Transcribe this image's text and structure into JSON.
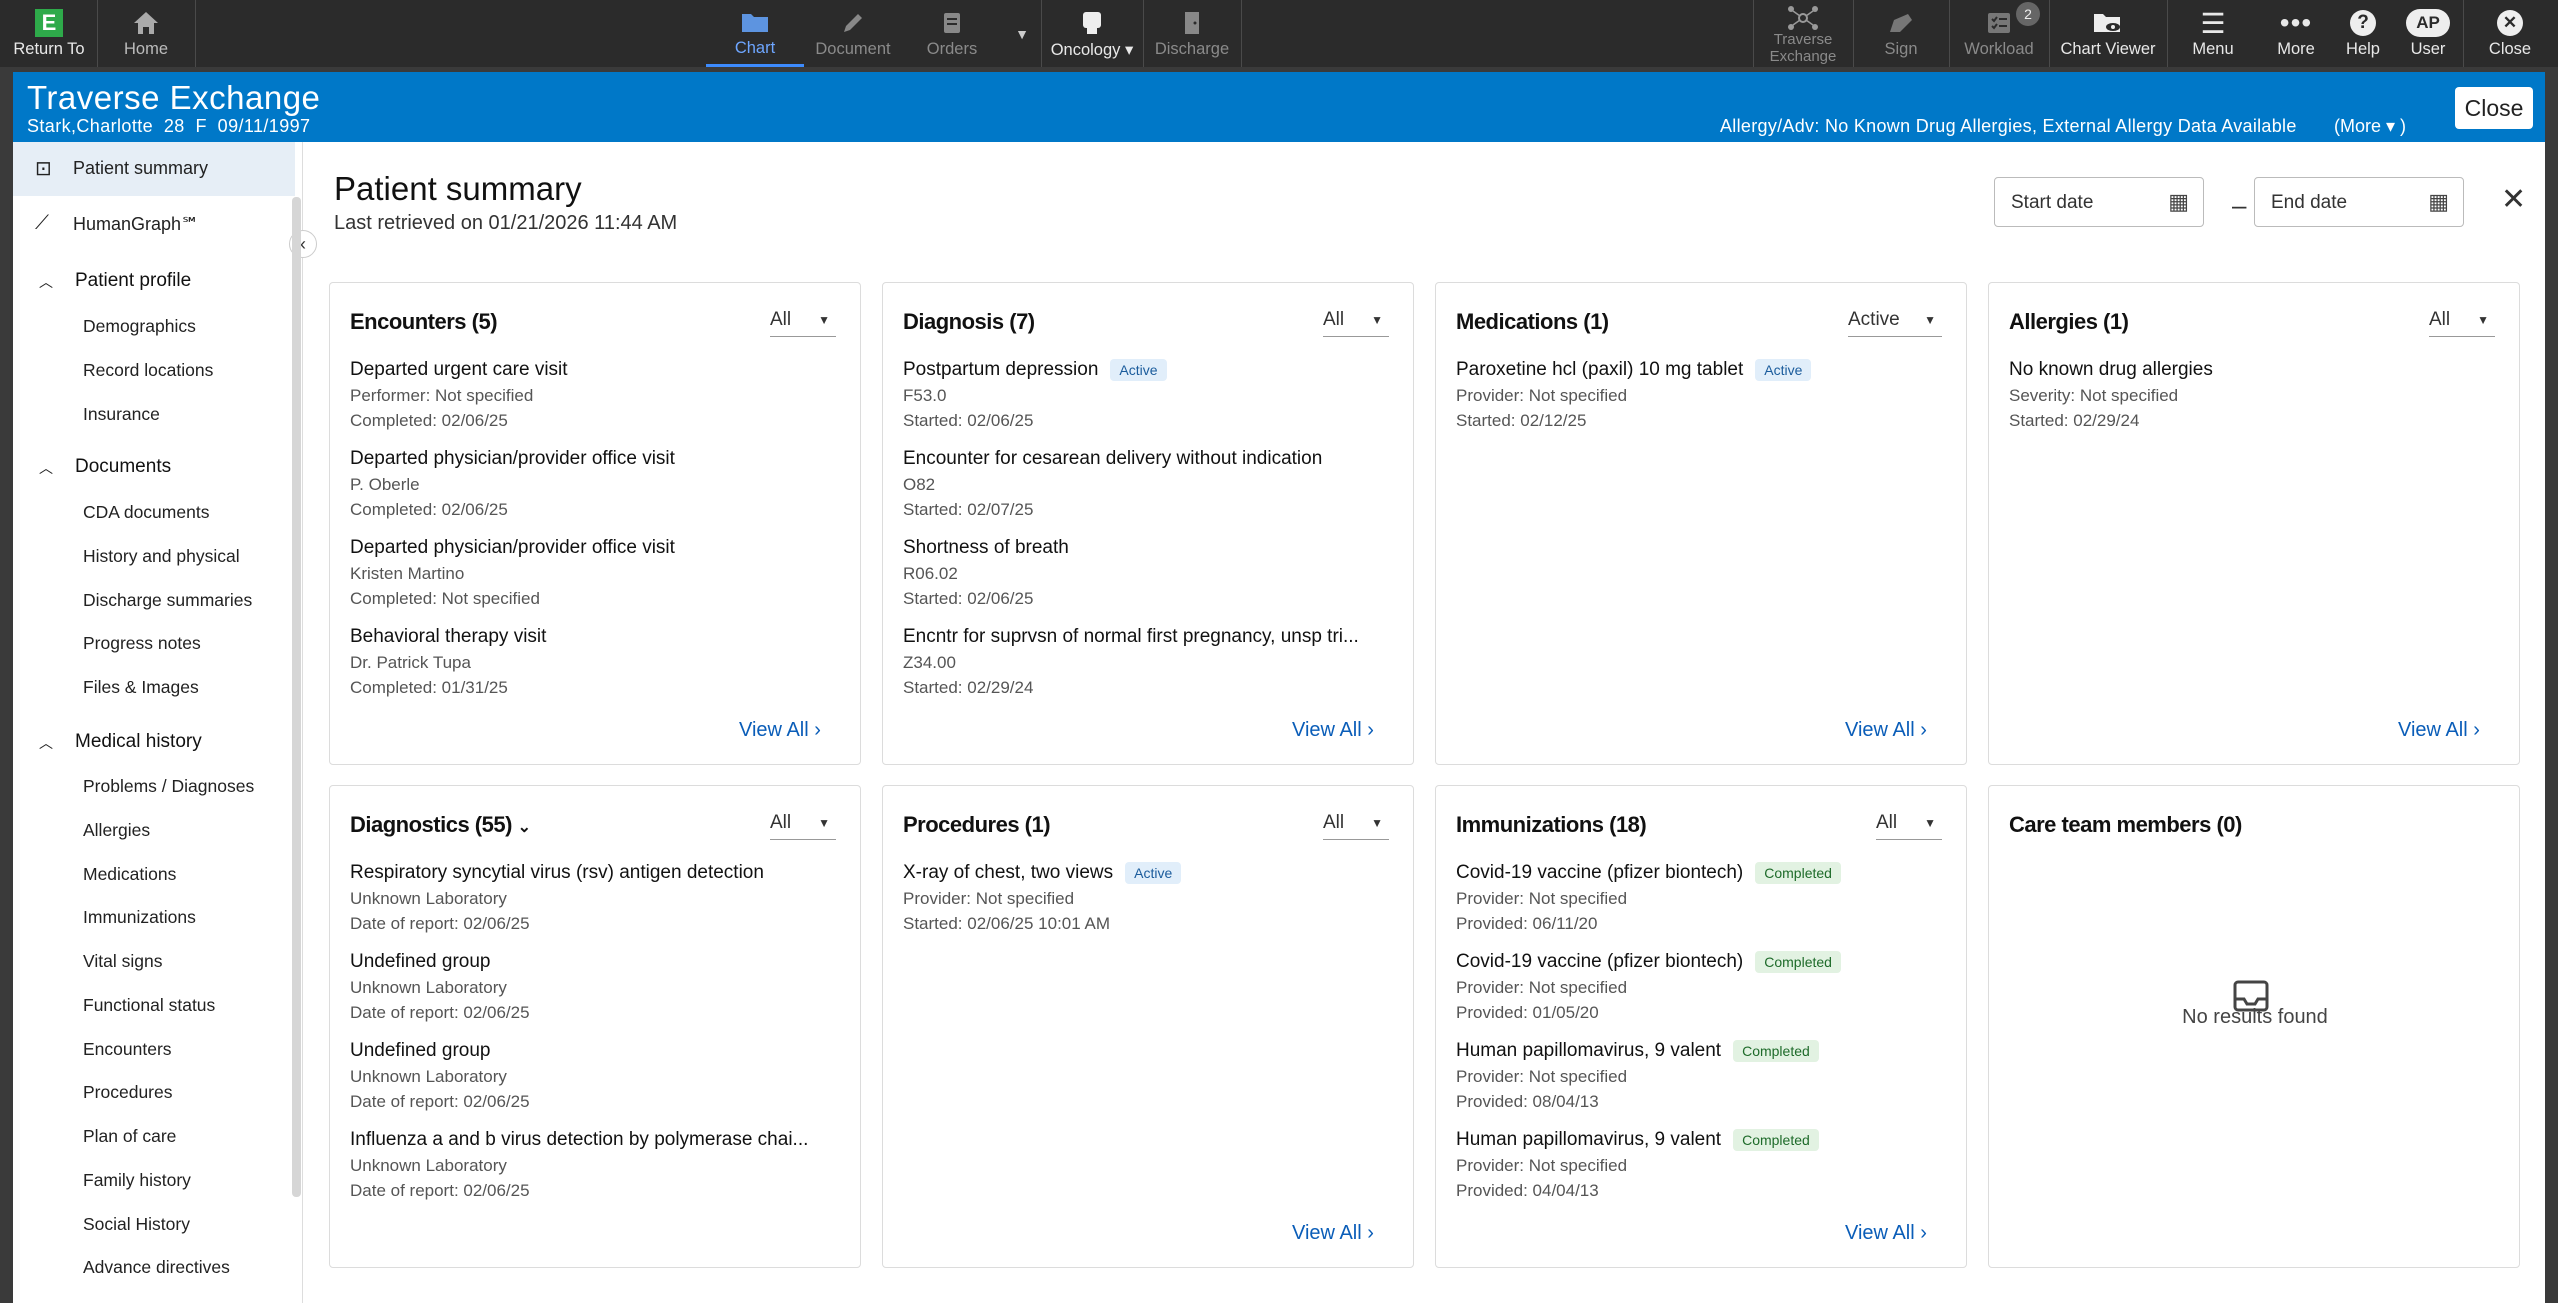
{
  "toolbar": {
    "return_to": "Return To",
    "home": "Home",
    "chart": "Chart",
    "document": "Document",
    "orders": "Orders",
    "oncology": "Oncology",
    "discharge": "Discharge",
    "traverse_exchange": "Traverse\nExchange",
    "sign": "Sign",
    "workload": "Workload",
    "workload_count": "2",
    "chart_viewer": "Chart Viewer",
    "menu": "Menu",
    "more": "More",
    "help": "Help",
    "user": "User",
    "user_initials": "AP",
    "close": "Close"
  },
  "header": {
    "title": "Traverse Exchange",
    "patient": "Stark,Charlotte  28  F  09/11/1997",
    "allergy": "Allergy/Adv: No Known Drug Allergies, External Allergy Data Available",
    "more": "(More ▾ )",
    "close": "Close"
  },
  "sidebar": {
    "patient_summary": "Patient summary",
    "humangraph": "HumanGraph℠",
    "patient_profile": "Patient profile",
    "demographics": "Demographics",
    "record_locations": "Record locations",
    "insurance": "Insurance",
    "documents": "Documents",
    "cda_documents": "CDA documents",
    "history_and_physical": "History and physical",
    "discharge_summaries": "Discharge summaries",
    "progress_notes": "Progress notes",
    "files_images": "Files & Images",
    "medical_history": "Medical history",
    "problems": "Problems / Diagnoses",
    "allergies": "Allergies",
    "medications": "Medications",
    "immunizations": "Immunizations",
    "vital_signs": "Vital signs",
    "functional_status": "Functional status",
    "encounters": "Encounters",
    "procedures": "Procedures",
    "plan_of_care": "Plan of care",
    "family_history": "Family history",
    "social_history": "Social History",
    "advance_directives": "Advance directives"
  },
  "main": {
    "title": "Patient summary",
    "retrieved": "Last retrieved on 01/21/2026 11:44 AM",
    "start_date": "Start date",
    "end_date": "End date",
    "dash": "–"
  },
  "cards": {
    "encounters": {
      "title": "Encounters (5)",
      "filter": "All",
      "view_all": "View All",
      "items": [
        {
          "t1": "Departed urgent care visit",
          "t2": "Performer: Not specified",
          "t3": "Completed: 02/06/25"
        },
        {
          "t1": "Departed physician/provider office visit",
          "t2": "P. Oberle",
          "t3": "Completed: 02/06/25"
        },
        {
          "t1": "Departed physician/provider office visit",
          "t2": "Kristen Martino",
          "t3": "Completed: Not specified"
        },
        {
          "t1": "Behavioral therapy visit",
          "t2": "Dr. Patrick Tupa",
          "t3": "Completed: 01/31/25"
        }
      ]
    },
    "diagnosis": {
      "title": "Diagnosis (7)",
      "filter": "All",
      "view_all": "View All",
      "items": [
        {
          "t1": "Postpartum depression",
          "badge": "Active",
          "t2": "F53.0",
          "t3": "Started: 02/06/25"
        },
        {
          "t1": "Encounter for cesarean delivery without indication",
          "t2": "O82",
          "t3": "Started: 02/07/25"
        },
        {
          "t1": "Shortness of breath",
          "t2": "R06.02",
          "t3": "Started: 02/06/25"
        },
        {
          "t1": "Encntr for suprvsn of normal first pregnancy, unsp tri...",
          "t2": "Z34.00",
          "t3": "Started: 02/29/24"
        }
      ]
    },
    "medications": {
      "title": "Medications (1)",
      "filter": "Active",
      "view_all": "View All",
      "items": [
        {
          "t1": "Paroxetine hcl (paxil) 10 mg tablet",
          "badge": "Active",
          "t2": "Provider: Not specified",
          "t3": "Started: 02/12/25"
        }
      ]
    },
    "allergies": {
      "title": "Allergies (1)",
      "filter": "All",
      "view_all": "View All",
      "items": [
        {
          "t1": "No known drug allergies",
          "t2": "Severity: Not specified",
          "t3": "Started: 02/29/24"
        }
      ]
    },
    "diagnostics": {
      "title": "Diagnostics (55)",
      "filter": "All",
      "items": [
        {
          "t1": "Respiratory syncytial virus (rsv) antigen detection",
          "t2": "Unknown Laboratory",
          "t3": "Date of report: 02/06/25"
        },
        {
          "t1": "Undefined group",
          "t2": "Unknown Laboratory",
          "t3": "Date of report: 02/06/25"
        },
        {
          "t1": "Undefined group",
          "t2": "Unknown Laboratory",
          "t3": "Date of report: 02/06/25"
        },
        {
          "t1": "Influenza a and b virus detection by polymerase chai...",
          "t2": "Unknown Laboratory",
          "t3": "Date of report: 02/06/25"
        }
      ]
    },
    "procedures": {
      "title": "Procedures (1)",
      "filter": "All",
      "view_all": "View All",
      "items": [
        {
          "t1": "X-ray of chest, two views",
          "badge": "Active",
          "t2": "Provider: Not specified",
          "t3": "Started: 02/06/25 10:01 AM"
        }
      ]
    },
    "immunizations": {
      "title": "Immunizations (18)",
      "filter": "All",
      "view_all": "View All",
      "items": [
        {
          "t1": "Covid-19 vaccine (pfizer biontech)",
          "badge": "Completed",
          "t2": "Provider: Not specified",
          "t3": "Provided: 06/11/20"
        },
        {
          "t1": "Covid-19 vaccine (pfizer biontech)",
          "badge": "Completed",
          "t2": "Provider: Not specified",
          "t3": "Provided: 01/05/20"
        },
        {
          "t1": "Human papillomavirus, 9 valent",
          "badge": "Completed",
          "t2": "Provider: Not specified",
          "t3": "Provided: 08/04/13"
        },
        {
          "t1": "Human papillomavirus, 9 valent",
          "badge": "Completed",
          "t2": "Provider: Not specified",
          "t3": "Provided: 04/04/13"
        }
      ]
    },
    "care_team": {
      "title": "Care team members (0)",
      "no_results": "No results found"
    }
  },
  "colors": {
    "header_blue": "#0078c8",
    "toolbar": "#2b2b2b",
    "link": "#0a5db8",
    "green_logo": "#2eaa4a"
  }
}
